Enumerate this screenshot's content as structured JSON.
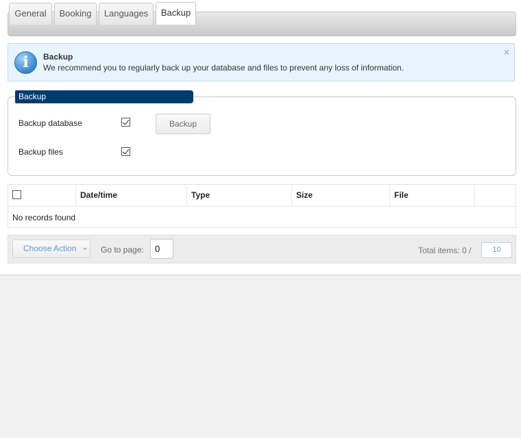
{
  "tabs": [
    {
      "label": "General",
      "active": false
    },
    {
      "label": "Booking",
      "active": false
    },
    {
      "label": "Languages",
      "active": false
    },
    {
      "label": "Backup",
      "active": true
    }
  ],
  "info": {
    "icon": "info-icon",
    "icon_glyph": "i",
    "title": "Backup",
    "text": "We recommend you to regularly back up your database and files to prevent any loss of information.",
    "close_glyph": "×"
  },
  "backup_form": {
    "legend": "Backup",
    "fields": [
      {
        "label": "Backup database",
        "checked": true
      },
      {
        "label": "Backup files",
        "checked": true
      }
    ],
    "button_label": "Backup"
  },
  "table": {
    "columns": [
      "Date/time",
      "Type",
      "Size",
      "File"
    ],
    "empty_text": "No records found"
  },
  "footer": {
    "action_label": "Choose Action",
    "goto_label": "Go to page:",
    "page_value": "0",
    "total_label": "Total items: 0 /",
    "per_page": "10"
  },
  "colors": {
    "legend_bg": "#003b6f",
    "info_bg": "#e8f4fb",
    "link_blue": "#5b9bd1"
  }
}
